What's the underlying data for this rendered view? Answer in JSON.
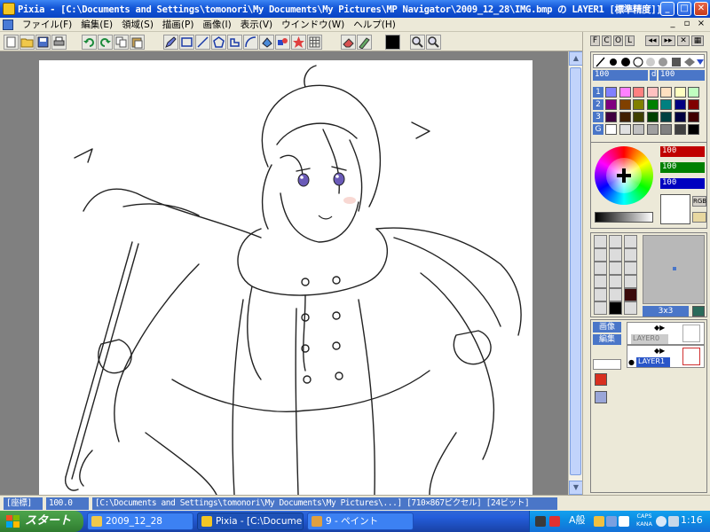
{
  "window": {
    "title": "Pixia - [C:\\Documents and Settings\\tomonori\\My Documents\\My Pictures\\MP Navigator\\2009_12_28\\IMG.bmp の LAYER1 [標準精度]]",
    "controls": {
      "minimize": "_",
      "maximize": "□",
      "close": "✕"
    }
  },
  "menu": {
    "items": [
      "ファイル(F)",
      "編集(E)",
      "領域(S)",
      "描画(P)",
      "画像(I)",
      "表示(V)",
      "ウインドウ(W)",
      "ヘルプ(H)"
    ],
    "mdi_controls": {
      "minimize": "_",
      "restore": "▫",
      "close": "×"
    }
  },
  "toolbar": {
    "tools": [
      "new-file-icon",
      "open-folder-icon",
      "save-icon",
      "print-icon",
      "undo-icon",
      "redo-icon",
      "copy-icon",
      "paste-icon",
      "pen-icon",
      "rectangle-icon",
      "line-icon",
      "polygon-icon",
      "lasso-icon",
      "curve-icon",
      "fill-icon",
      "shape-icon",
      "star-icon",
      "grid-icon",
      "eraser-icon",
      "airbrush-icon",
      "color-black-icon",
      "zoom-out-icon",
      "zoom-in-icon"
    ]
  },
  "panel": {
    "tabs": [
      "F",
      "C",
      "O",
      "L"
    ],
    "nav_buttons": [
      "◂◂",
      "▸▸",
      "✕",
      "▦"
    ],
    "opacity_value": "100",
    "density_label": "d",
    "density_value": "100",
    "palette_rows": [
      "1",
      "2",
      "3",
      "G"
    ],
    "palette_colors": [
      [
        "#8080ff",
        "#ff80ff",
        "#ff8080",
        "#ffc0c0",
        "#ffe0c0",
        "#ffffc0",
        "#c0ffc0"
      ],
      [
        "#800080",
        "#804000",
        "#808000",
        "#008000",
        "#008080",
        "#000080",
        "#800000"
      ],
      [
        "#400040",
        "#402000",
        "#404000",
        "#004000",
        "#004040",
        "#000040",
        "#400000"
      ],
      [
        "#ffffff",
        "#e0e0e0",
        "#c0c0c0",
        "#a0a0a0",
        "#808080",
        "#404040",
        "#000000"
      ]
    ],
    "rgb": {
      "r": "100",
      "g": "100",
      "b": "100"
    },
    "rgb_button": "RGB",
    "brush_size": "3x3",
    "layers": {
      "image_button": "画像",
      "edit_button": "編集",
      "layer0_name": "LAYER0",
      "layer1_name": "LAYER1"
    }
  },
  "canvas": {
    "art": "line-drawing-character-in-coat-and-scarf"
  },
  "statusbar": {
    "mode": "[座標]",
    "zoom": "100.0",
    "path": "[C:\\Documents and Settings\\tomonori\\My Documents\\My Pictures\\...] [710×867ピクセル] [24ビット]"
  },
  "taskbar": {
    "start": "スタート",
    "tasks": [
      "2009_12_28",
      "Pixia - [C:\\Document...",
      "9 - ペイント"
    ],
    "ime": "A般",
    "caps_top": "CAPS",
    "caps_bottom": "KANA",
    "clock": "1:16"
  },
  "colors": {
    "titlebar": "#0a45c5",
    "accent": "#4a76c8",
    "canvas_bg": "#ffffff",
    "workspace": "#808080"
  }
}
